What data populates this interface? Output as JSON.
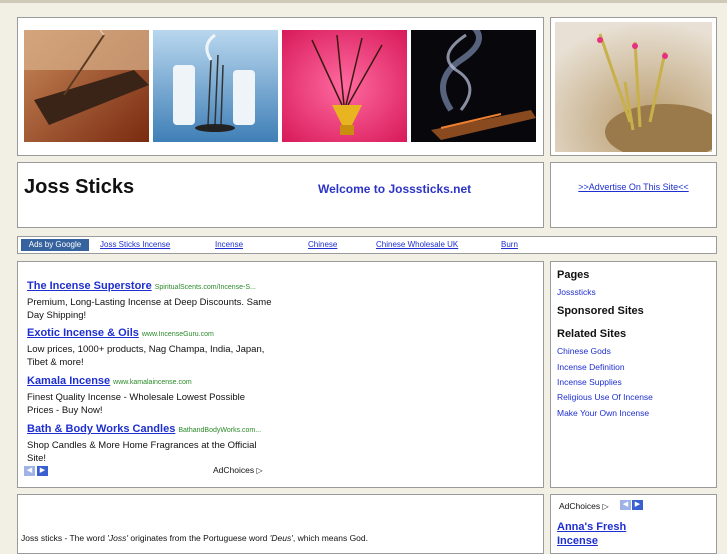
{
  "header": {
    "title": "Joss Sticks",
    "welcome": "Welcome to Josssticks.net",
    "advertise": ">>Advertise On This Site<<"
  },
  "adsbar": {
    "badge": "Ads by Google",
    "links": [
      "Joss Sticks Incense",
      "Incense",
      "Chinese",
      "Chinese Wholesale UK",
      "Burn"
    ]
  },
  "ads": [
    {
      "title": "The Incense Superstore",
      "url": "SpiritualScents.com/Incense-S...",
      "desc": "Premium, Long-Lasting Incense at Deep Discounts. Same Day Shipping!"
    },
    {
      "title": "Exotic Incense & Oils",
      "url": "www.IncenseGuru.com",
      "desc": "Low prices, 1000+ products, Nag Champa, India, Japan, Tibet & more!"
    },
    {
      "title": "Kamala Incense",
      "url": "www.kamalaincense.com",
      "desc": "Finest Quality Incense - Wholesale Lowest Possible Prices - Buy Now!"
    },
    {
      "title": "Bath & Body Works Candles",
      "url": "BathandBodyWorks.com...",
      "desc": "Shop Candles & More Home Fragrances at the Official Site!"
    }
  ],
  "adchoices": "AdChoices",
  "sidebar": {
    "pages_heading": "Pages",
    "pages": [
      "Josssticks"
    ],
    "sponsored_heading": "Sponsored Sites",
    "related_heading": "Related Sites",
    "related": [
      "Chinese Gods",
      "Incense Definition",
      "Incense Supplies",
      "Religious Use Of Incense",
      "Make Your Own Incense"
    ]
  },
  "bottom": {
    "intro_prefix": "Joss sticks - The word ",
    "intro_joss": "Joss",
    "intro_mid": " originates from the Portuguese word ",
    "intro_deus": "Deus",
    "intro_suffix": ", which means God.",
    "adchoices": "AdChoices",
    "side_ad_title_1": "Anna's Fresh",
    "side_ad_title_2": "Incense"
  },
  "colors": {
    "link": "#1f2fcf",
    "badge": "#36639e",
    "adurl": "#2a8a2a",
    "navbtn": "#3a5fd0"
  }
}
